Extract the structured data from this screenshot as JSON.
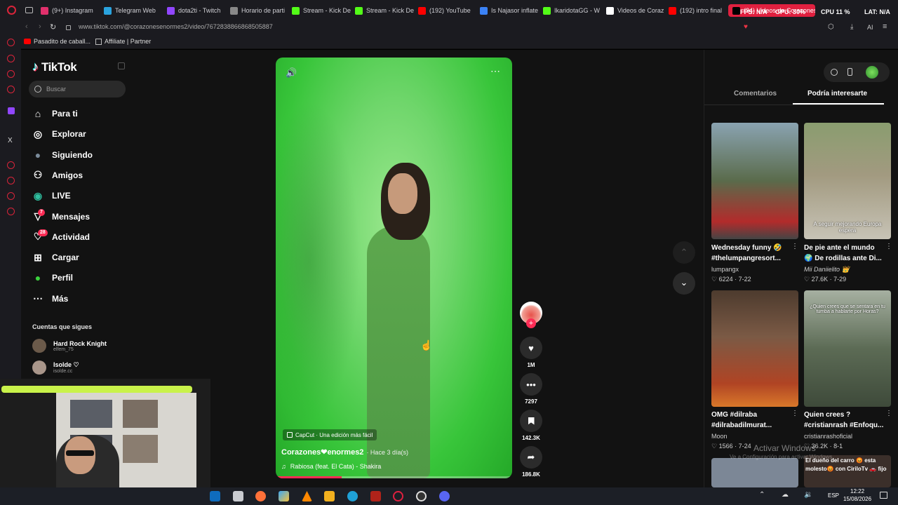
{
  "tabs": [
    {
      "label": "(9+) Instagram",
      "color": "#e1306c"
    },
    {
      "label": "Telegram Web",
      "color": "#2aa3de"
    },
    {
      "label": "dota2ti - Twitch",
      "color": "#9146ff"
    },
    {
      "label": "Horario de parti",
      "color": "#888888"
    },
    {
      "label": "Stream - Kick De",
      "color": "#53fc18"
    },
    {
      "label": "Stream - Kick De",
      "color": "#53fc18"
    },
    {
      "label": "(192) YouTube",
      "color": "#ff0000"
    },
    {
      "label": "Is Najasor inflate",
      "color": "#3b82f6"
    },
    {
      "label": "IkaridotaGG - W",
      "color": "#53fc18"
    },
    {
      "label": "Videos de Coraz",
      "color": "#ffffff"
    },
    {
      "label": "(192) intro final",
      "color": "#ff0000"
    }
  ],
  "active_tab": "(34) Videos de Corazones",
  "perf": {
    "fps": "FPS: N/A",
    "gpu": "GPU: 30%",
    "cpu": "CPU 11 %",
    "lat": "LAT: N/A"
  },
  "address": "www.tiktok.com/@corazonesenormes2/video/7672838866868505887",
  "bookmarks": [
    {
      "label": "Pasadito de caball..."
    },
    {
      "label": "Affiliate | Partner"
    }
  ],
  "colors": {
    "brand_red": "#fe2c55",
    "accent_green": "#3bd23d",
    "bg": "#121212"
  },
  "tiktok": {
    "logo": "TikTok",
    "search_placeholder": "Buscar",
    "nav": [
      {
        "label": "Para ti",
        "icon": "home-icon"
      },
      {
        "label": "Explorar",
        "icon": "compass-icon"
      },
      {
        "label": "Siguiendo",
        "icon": "avatar-icon"
      },
      {
        "label": "Amigos",
        "icon": "friends-icon"
      },
      {
        "label": "LIVE",
        "icon": "live-icon"
      },
      {
        "label": "Mensajes",
        "icon": "messages-icon",
        "badge": "7"
      },
      {
        "label": "Actividad",
        "icon": "activity-icon",
        "badge": "28"
      },
      {
        "label": "Cargar",
        "icon": "upload-icon"
      },
      {
        "label": "Perfil",
        "icon": "profile-icon"
      },
      {
        "label": "Más",
        "icon": "more-icon"
      }
    ],
    "following_header": "Cuentas que sigues",
    "following": [
      {
        "name": "Hard Rock Knight",
        "handle": "elfem_75"
      },
      {
        "name": "Isolde ♡",
        "handle": "isolde.cc"
      }
    ]
  },
  "video": {
    "capcut": "CapCut · Una edición más fácil",
    "author": "Corazones❤enormes2",
    "time": "· Hace 3 día(s)",
    "music": "Rabiosa (feat. El Cata) - Shakira",
    "likes": "1M",
    "comments": "7297",
    "saves": "142.3K",
    "shares": "186.8K",
    "progress": 0.28
  },
  "right": {
    "tabs": [
      "Comentarios",
      "Podría interesarte"
    ],
    "active_tab": "Podría interesarte",
    "items": [
      {
        "title": "Wednesday funny 🤣",
        "title2": "#thelumpangresort...",
        "author": "lumpangx",
        "likes": "6224",
        "date": "7-22",
        "overlay": "",
        "color": "#6b7f5c"
      },
      {
        "title": "De pie ante el mundo",
        "title2": "🌍 De rodillas ante Di...",
        "author": "Mii Daniielito 👑",
        "likes": "27.6K",
        "date": "7-29",
        "overlay": "A seguir mejorando Europa espera",
        "color": "#8a8b76"
      },
      {
        "title": "OMG #dilraba",
        "title2": "#dilrabadilmurat...",
        "author": "Moon",
        "likes": "1566",
        "date": "7-24",
        "overlay": "",
        "color": "#7b5a45"
      },
      {
        "title": "Quien crees ?",
        "title2": "#cristianrash #Enfoqu...",
        "author": "cristianrashoficial",
        "likes": "36.2K",
        "date": "8-1",
        "overlay": "¿Quien crees que se sentara en tu tumba a hablarte por Horas?",
        "color": "#5c6b55"
      }
    ],
    "watermark": "Activar Windows",
    "watermark_sub": "Ve a Configuración para activar Windows.",
    "bottom_caption": "El dueño del carro 😡 esta molesto😡 con CiriloTv 🚗 fijo"
  },
  "taskbar": {
    "lang": "ESP",
    "time": "12:22",
    "date": "15/08/2026"
  }
}
